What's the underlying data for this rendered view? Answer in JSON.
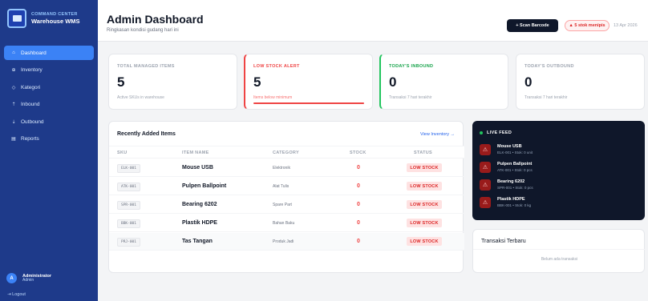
{
  "brand": {
    "subtitle": "COMMAND CENTER",
    "title": "Warehouse WMS"
  },
  "nav": [
    {
      "label": "Dashboard",
      "icon": "home-icon",
      "glyph": "⌂",
      "active": true
    },
    {
      "label": "Inventory",
      "icon": "box-icon",
      "glyph": "⊕",
      "active": false
    },
    {
      "label": "Kategori",
      "icon": "tag-icon",
      "glyph": "◇",
      "active": false
    },
    {
      "label": "Inbound",
      "icon": "upload-icon",
      "glyph": "⇡",
      "active": false
    },
    {
      "label": "Outbound",
      "icon": "download-icon",
      "glyph": "⇣",
      "active": false
    },
    {
      "label": "Reports",
      "icon": "report-icon",
      "glyph": "▤",
      "active": false
    }
  ],
  "user": {
    "initial": "A",
    "name": "Administrator",
    "role": "Admin",
    "logout": "Logout"
  },
  "header": {
    "title": "Admin Dashboard",
    "subtitle": "Ringkasan kondisi gudang hari ini",
    "scan_label": "+ Scan Barcode",
    "alert_label": "▲ 5 stok menipis",
    "date": "13 Apr 2026"
  },
  "stats": [
    {
      "label": "TOTAL MANAGED ITEMS",
      "value": "5",
      "desc": "Active SKUs in warehouse"
    },
    {
      "label": "LOW STOCK ALERT",
      "value": "5",
      "desc": "Items below minimum"
    },
    {
      "label": "TODAY'S INBOUND",
      "value": "0",
      "desc": "Transaksi 7 hari terakhir"
    },
    {
      "label": "TODAY'S OUTBOUND",
      "value": "0",
      "desc": "Transaksi 7 hari terakhir"
    }
  ],
  "recent": {
    "title": "Recently Added Items",
    "link": "View Inventory →",
    "columns": [
      "SKU",
      "ITEM NAME",
      "CATEGORY",
      "STOCK",
      "STATUS"
    ],
    "rows": [
      {
        "sku": "ELK-001",
        "name": "Mouse USB",
        "category": "Elektronik",
        "stock": "0",
        "status": "LOW STOCK"
      },
      {
        "sku": "ATK-001",
        "name": "Pulpen Ballpoint",
        "category": "Alat Tulis",
        "stock": "0",
        "status": "LOW STOCK"
      },
      {
        "sku": "SPR-001",
        "name": "Bearing 6202",
        "category": "Spare Part",
        "stock": "0",
        "status": "LOW STOCK"
      },
      {
        "sku": "BBK-001",
        "name": "Plastik HDPE",
        "category": "Bahan Baku",
        "stock": "0",
        "status": "LOW STOCK"
      },
      {
        "sku": "PRJ-001",
        "name": "Tas Tangan",
        "category": "Produk Jadi",
        "stock": "0",
        "status": "LOW STOCK"
      }
    ]
  },
  "feed": {
    "title": "LIVE FEED",
    "items": [
      {
        "title": "Mouse USB",
        "sub": "ELK-001 • Stok: 0 unit"
      },
      {
        "title": "Pulpen Ballpoint",
        "sub": "ATK-001 • Stok: 0 pcs"
      },
      {
        "title": "Bearing 6202",
        "sub": "SPR-001 • Stok: 0 pcs"
      },
      {
        "title": "Plastik HDPE",
        "sub": "BBK-001 • Stok: 0 kg"
      }
    ]
  },
  "transactions": {
    "title": "Transaksi Terbaru",
    "empty": "Belum ada transaksi"
  },
  "colors": {
    "sidebar": "#1e3a8a",
    "active": "#3b82f6",
    "danger": "#ef4444",
    "success": "#22c55e",
    "dark": "#0f172a"
  }
}
